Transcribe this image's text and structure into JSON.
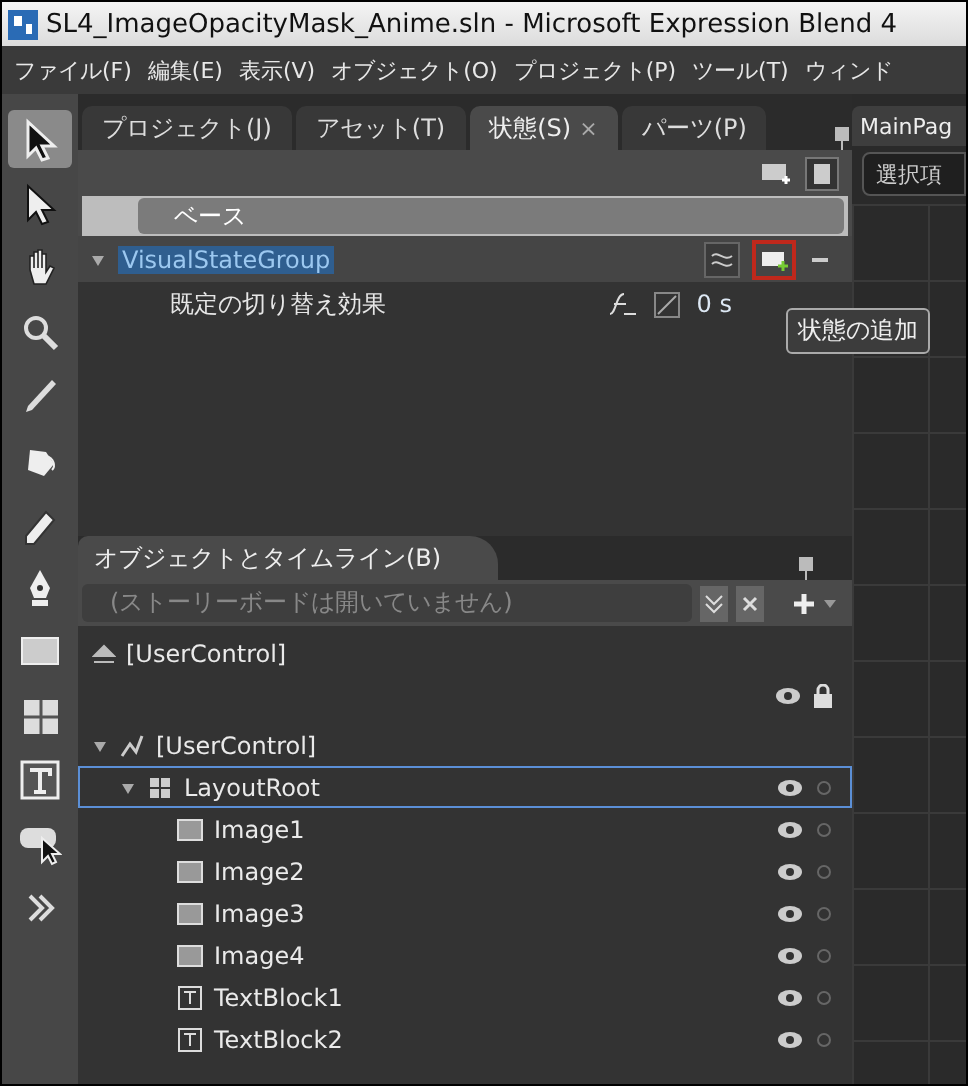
{
  "window": {
    "title": "SL4_ImageOpacityMask_Anime.sln - Microsoft Expression Blend 4"
  },
  "menu": [
    "ファイル(F)",
    "編集(E)",
    "表示(V)",
    "オブジェクト(O)",
    "プロジェクト(P)",
    "ツール(T)",
    "ウィンド"
  ],
  "tools": [
    {
      "kind": "select",
      "selected": true
    },
    {
      "kind": "direct",
      "selected": false
    },
    {
      "kind": "hand",
      "selected": false
    },
    {
      "kind": "zoom",
      "selected": false
    },
    {
      "kind": "dropper",
      "selected": false
    },
    {
      "kind": "bucket",
      "selected": false
    },
    {
      "kind": "pencil",
      "selected": false
    },
    {
      "kind": "pen",
      "selected": false
    },
    {
      "kind": "rect",
      "selected": false
    },
    {
      "kind": "grid",
      "selected": false
    },
    {
      "kind": "text",
      "selected": false
    },
    {
      "kind": "control",
      "selected": false
    },
    {
      "kind": "more",
      "selected": false
    }
  ],
  "tabs": [
    {
      "label": "プロジェクト(J)",
      "selected": false
    },
    {
      "label": "アセット(T)",
      "selected": false
    },
    {
      "label": "状態(S)",
      "selected": true,
      "close": "×"
    },
    {
      "label": "パーツ(P)",
      "selected": false
    }
  ],
  "states": {
    "base": "ベース",
    "group": {
      "name": "VisualStateGroup",
      "selected": true
    },
    "transition": {
      "label": "既定の切り替え効果",
      "duration": "0 s"
    },
    "tooltip": "状態の追加"
  },
  "objects": {
    "title": "オブジェクトとタイムライン(B)",
    "storyboard": "(ストーリーボードは開いていません)",
    "scope": "[UserControl]",
    "tree": [
      {
        "name": "[UserControl]",
        "kind": "control",
        "expanded": true,
        "selected": false,
        "children": [
          {
            "name": "LayoutRoot",
            "kind": "grid",
            "expanded": true,
            "selected": true,
            "children": [
              {
                "name": "Image1",
                "kind": "image",
                "selected": false
              },
              {
                "name": "Image2",
                "kind": "image",
                "selected": false
              },
              {
                "name": "Image3",
                "kind": "image",
                "selected": false
              },
              {
                "name": "Image4",
                "kind": "image",
                "selected": false
              },
              {
                "name": "TextBlock1",
                "kind": "text",
                "selected": false
              },
              {
                "name": "TextBlock2",
                "kind": "text",
                "selected": false
              }
            ]
          }
        ]
      }
    ]
  },
  "document": {
    "tab": "MainPag",
    "field": "選択項"
  }
}
